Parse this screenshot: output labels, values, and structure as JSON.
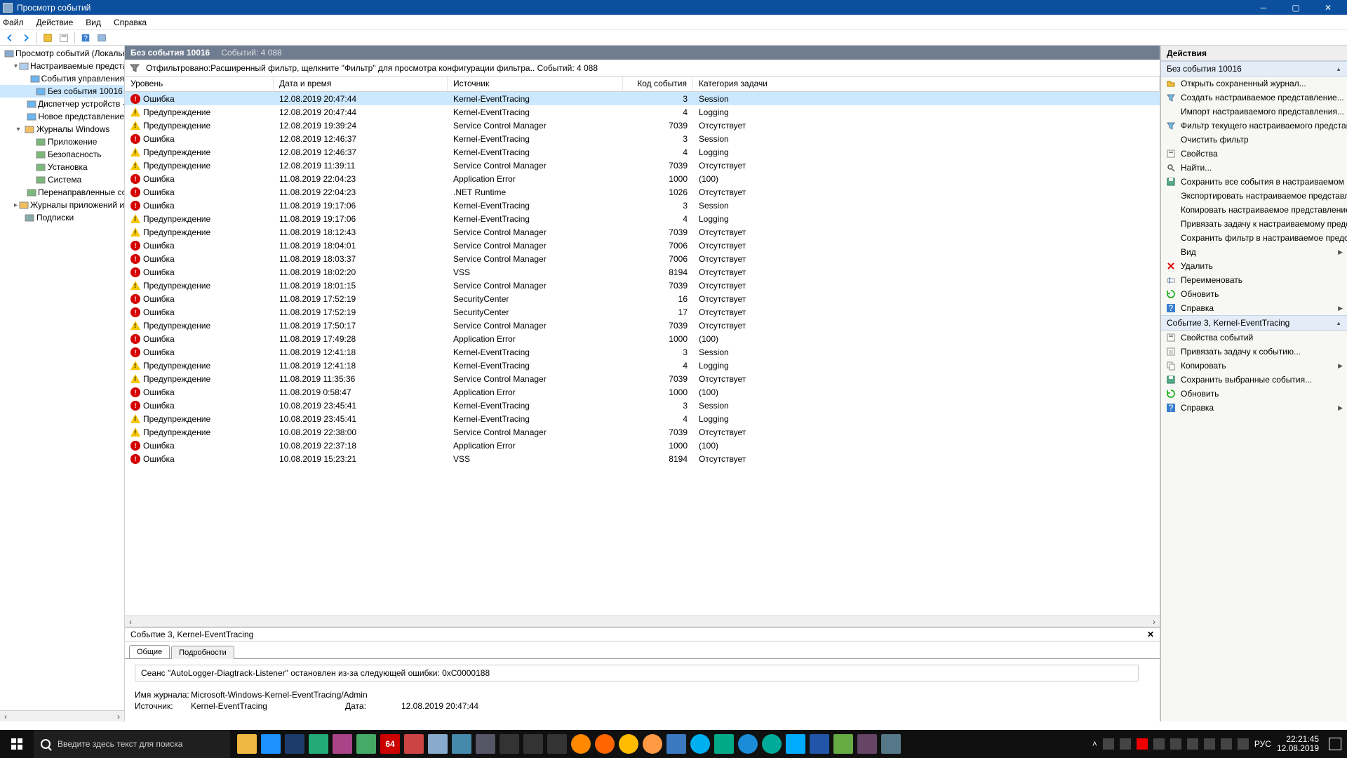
{
  "title": "Просмотр событий",
  "menus": [
    "Файл",
    "Действие",
    "Вид",
    "Справка"
  ],
  "tree": {
    "root": "Просмотр событий (Локальный)",
    "customViews": "Настраиваемые представления",
    "customChildren": [
      "События управления",
      "Без события 10016",
      "Диспетчер устройств - V…",
      "Новое представление"
    ],
    "selectedIndex": 1,
    "winLogs": "Журналы Windows",
    "winChildren": [
      "Приложение",
      "Безопасность",
      "Установка",
      "Система",
      "Перенаправленные события"
    ],
    "appLogs": "Журналы приложений и служб",
    "subs": "Подписки"
  },
  "center": {
    "viewName": "Без события 10016",
    "countLabel": "Событий: 4 088",
    "filterText": "Отфильтровано:Расширенный фильтр, щелкните \"Фильтр\" для просмотра конфигурации фильтра.. Событий: 4 088",
    "columns": {
      "level": "Уровень",
      "date": "Дата и время",
      "src": "Источник",
      "code": "Код события",
      "cat": "Категория задачи"
    }
  },
  "levels": {
    "error": "Ошибка",
    "warn": "Предупреждение"
  },
  "events": [
    {
      "l": "error",
      "d": "12.08.2019 20:47:44",
      "s": "Kernel-EventTracing",
      "c": 3,
      "t": "Session",
      "sel": true
    },
    {
      "l": "warn",
      "d": "12.08.2019 20:47:44",
      "s": "Kernel-EventTracing",
      "c": 4,
      "t": "Logging"
    },
    {
      "l": "warn",
      "d": "12.08.2019 19:39:24",
      "s": "Service Control Manager",
      "c": 7039,
      "t": "Отсутствует"
    },
    {
      "l": "error",
      "d": "12.08.2019 12:46:37",
      "s": "Kernel-EventTracing",
      "c": 3,
      "t": "Session"
    },
    {
      "l": "warn",
      "d": "12.08.2019 12:46:37",
      "s": "Kernel-EventTracing",
      "c": 4,
      "t": "Logging"
    },
    {
      "l": "warn",
      "d": "12.08.2019 11:39:11",
      "s": "Service Control Manager",
      "c": 7039,
      "t": "Отсутствует"
    },
    {
      "l": "error",
      "d": "11.08.2019 22:04:23",
      "s": "Application Error",
      "c": 1000,
      "t": "(100)"
    },
    {
      "l": "error",
      "d": "11.08.2019 22:04:23",
      "s": ".NET Runtime",
      "c": 1026,
      "t": "Отсутствует"
    },
    {
      "l": "error",
      "d": "11.08.2019 19:17:06",
      "s": "Kernel-EventTracing",
      "c": 3,
      "t": "Session"
    },
    {
      "l": "warn",
      "d": "11.08.2019 19:17:06",
      "s": "Kernel-EventTracing",
      "c": 4,
      "t": "Logging"
    },
    {
      "l": "warn",
      "d": "11.08.2019 18:12:43",
      "s": "Service Control Manager",
      "c": 7039,
      "t": "Отсутствует"
    },
    {
      "l": "error",
      "d": "11.08.2019 18:04:01",
      "s": "Service Control Manager",
      "c": 7006,
      "t": "Отсутствует"
    },
    {
      "l": "error",
      "d": "11.08.2019 18:03:37",
      "s": "Service Control Manager",
      "c": 7006,
      "t": "Отсутствует"
    },
    {
      "l": "error",
      "d": "11.08.2019 18:02:20",
      "s": "VSS",
      "c": 8194,
      "t": "Отсутствует"
    },
    {
      "l": "warn",
      "d": "11.08.2019 18:01:15",
      "s": "Service Control Manager",
      "c": 7039,
      "t": "Отсутствует"
    },
    {
      "l": "error",
      "d": "11.08.2019 17:52:19",
      "s": "SecurityCenter",
      "c": 16,
      "t": "Отсутствует"
    },
    {
      "l": "error",
      "d": "11.08.2019 17:52:19",
      "s": "SecurityCenter",
      "c": 17,
      "t": "Отсутствует"
    },
    {
      "l": "warn",
      "d": "11.08.2019 17:50:17",
      "s": "Service Control Manager",
      "c": 7039,
      "t": "Отсутствует"
    },
    {
      "l": "error",
      "d": "11.08.2019 17:49:28",
      "s": "Application Error",
      "c": 1000,
      "t": "(100)"
    },
    {
      "l": "error",
      "d": "11.08.2019 12:41:18",
      "s": "Kernel-EventTracing",
      "c": 3,
      "t": "Session"
    },
    {
      "l": "warn",
      "d": "11.08.2019 12:41:18",
      "s": "Kernel-EventTracing",
      "c": 4,
      "t": "Logging"
    },
    {
      "l": "warn",
      "d": "11.08.2019 11:35:36",
      "s": "Service Control Manager",
      "c": 7039,
      "t": "Отсутствует"
    },
    {
      "l": "error",
      "d": "11.08.2019 0:58:47",
      "s": "Application Error",
      "c": 1000,
      "t": "(100)"
    },
    {
      "l": "error",
      "d": "10.08.2019 23:45:41",
      "s": "Kernel-EventTracing",
      "c": 3,
      "t": "Session"
    },
    {
      "l": "warn",
      "d": "10.08.2019 23:45:41",
      "s": "Kernel-EventTracing",
      "c": 4,
      "t": "Logging"
    },
    {
      "l": "warn",
      "d": "10.08.2019 22:38:00",
      "s": "Service Control Manager",
      "c": 7039,
      "t": "Отсутствует"
    },
    {
      "l": "error",
      "d": "10.08.2019 22:37:18",
      "s": "Application Error",
      "c": 1000,
      "t": "(100)"
    },
    {
      "l": "error",
      "d": "10.08.2019 15:23:21",
      "s": "VSS",
      "c": 8194,
      "t": "Отсутствует"
    }
  ],
  "detail": {
    "title": "Событие 3, Kernel-EventTracing",
    "tabs": {
      "general": "Общие",
      "details": "Подробности"
    },
    "message": "Сеанс \"AutoLogger-Diagtrack-Listener\" остановлен из-за следующей ошибки: 0xC0000188",
    "fields": {
      "logNameLabel": "Имя журнала:",
      "logName": "Microsoft-Windows-Kernel-EventTracing/Admin",
      "srcLabel": "Источник:",
      "src": "Kernel-EventTracing",
      "dateLabel": "Дата:",
      "date": "12.08.2019 20:47:44"
    }
  },
  "actions": {
    "title": "Действия",
    "section1": "Без события 10016",
    "items1": [
      {
        "ico": "open",
        "t": "Открыть сохраненный журнал..."
      },
      {
        "ico": "filter",
        "t": "Создать настраиваемое представление..."
      },
      {
        "ico": "",
        "t": "Импорт настраиваемого представления..."
      },
      {
        "ico": "filter",
        "t": "Фильтр текущего настраиваемого представл..."
      },
      {
        "ico": "",
        "t": "Очистить фильтр"
      },
      {
        "ico": "props",
        "t": "Свойства"
      },
      {
        "ico": "find",
        "t": "Найти..."
      },
      {
        "ico": "save",
        "t": "Сохранить все события в настраиваемом пре..."
      },
      {
        "ico": "",
        "t": "Экспортировать настраиваемое представлен..."
      },
      {
        "ico": "",
        "t": "Копировать настраиваемое представление..."
      },
      {
        "ico": "",
        "t": "Привязать задачу к настраиваемому предста..."
      },
      {
        "ico": "",
        "t": "Сохранить фильтр в настраиваемое представ..."
      },
      {
        "ico": "",
        "t": "Вид",
        "sub": true
      },
      {
        "ico": "del",
        "t": "Удалить"
      },
      {
        "ico": "ren",
        "t": "Переименовать"
      },
      {
        "ico": "ref",
        "t": "Обновить"
      },
      {
        "ico": "help",
        "t": "Справка",
        "sub": true
      }
    ],
    "section2": "Событие 3, Kernel-EventTracing",
    "items2": [
      {
        "ico": "props",
        "t": "Свойства событий"
      },
      {
        "ico": "task",
        "t": "Привязать задачу к событию..."
      },
      {
        "ico": "copy",
        "t": "Копировать",
        "sub": true
      },
      {
        "ico": "save",
        "t": "Сохранить выбранные события..."
      },
      {
        "ico": "ref",
        "t": "Обновить"
      },
      {
        "ico": "help",
        "t": "Справка",
        "sub": true
      }
    ]
  },
  "taskbar": {
    "search": "Введите здесь текст для поиска",
    "lang": "РУС",
    "time": "22:21:45",
    "date": "12.08.2019"
  }
}
